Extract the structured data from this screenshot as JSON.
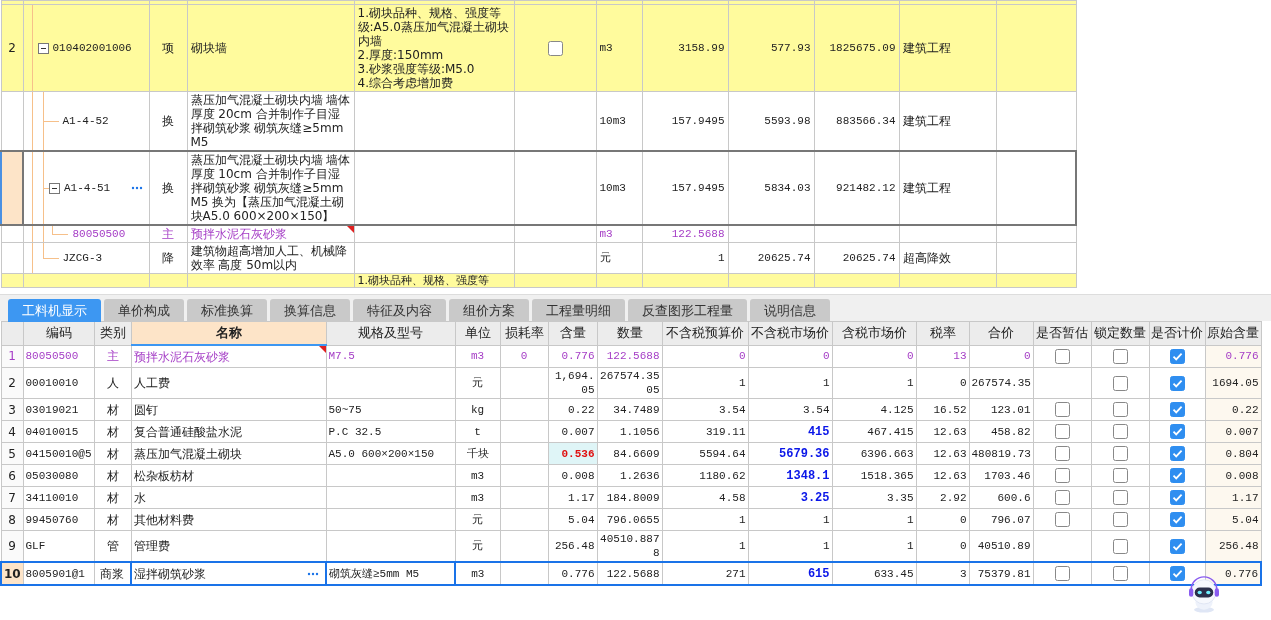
{
  "top_table": {
    "rows": [
      {
        "row_number": "2",
        "code": "010402001006",
        "type": "项",
        "kind": "item",
        "expanded": true,
        "name": "砌块墙",
        "features": "1.砌块品种、规格、强度等级:A5.0蒸压加气混凝土砌块内墙\n2.厚度:150mm\n3.砂浆强度等级:M5.0\n4.综合考虑增加费",
        "checked": false,
        "unit": "m3",
        "quantity": "3158.99",
        "unit_price": "577.93",
        "total": "1825675.09",
        "category": "建筑工程",
        "children": [
          {
            "code": "A1-4-52",
            "type": "换",
            "name": "蒸压加气混凝土砌块内墙 墙体厚度 20cm  合并制作子目湿拌砌筑砂浆 砌筑灰缝≥5mm M5",
            "unit": "10m3",
            "quantity": "157.9495",
            "unit_price": "5593.98",
            "total": "883566.34",
            "category": "建筑工程",
            "selected": false
          },
          {
            "code": "A1-4-51",
            "type": "换",
            "expanded": true,
            "name": "蒸压加气混凝土砌块内墙 墙体厚度 10cm  合并制作子目湿拌砌筑砂浆 砌筑灰缝≥5mm M5  换为【蒸压加气混凝土砌块A5.0 600×200×150】",
            "unit": "10m3",
            "quantity": "157.9495",
            "unit_price": "5834.03",
            "total": "921482.12",
            "category": "建筑工程",
            "selected": true,
            "children": [
              {
                "code": "80050500",
                "type": "主",
                "kind": "main-material",
                "name": "预拌水泥石灰砂浆",
                "flagged": true,
                "unit": "m3",
                "quantity": "122.5688",
                "selected": false
              }
            ]
          },
          {
            "code": "JZCG-3",
            "type": "降",
            "name": "建筑物超高增加人工、机械降效率 高度 50m以内",
            "unit": "元",
            "quantity": "1",
            "unit_price": "20625.74",
            "total": "20625.74",
            "category": "超高降效",
            "selected": false
          }
        ]
      },
      {
        "kind": "item",
        "features": "1.砌块品种、规格、强度等"
      }
    ]
  },
  "tabs": [
    {
      "label": "工料机显示",
      "selected": true
    },
    {
      "label": "单价构成",
      "selected": false
    },
    {
      "label": "标准换算",
      "selected": false
    },
    {
      "label": "换算信息",
      "selected": false
    },
    {
      "label": "特征及内容",
      "selected": false
    },
    {
      "label": "组价方案",
      "selected": false
    },
    {
      "label": "工程量明细",
      "selected": false
    },
    {
      "label": "反查图形工程量",
      "selected": false
    },
    {
      "label": "说明信息",
      "selected": false
    }
  ],
  "resource_table": {
    "columns": [
      {
        "label": "编码",
        "selected": false
      },
      {
        "label": "类别",
        "selected": false
      },
      {
        "label": "名称",
        "selected": true
      },
      {
        "label": "规格及型号",
        "selected": false
      },
      {
        "label": "单位",
        "selected": false
      },
      {
        "label": "损耗率",
        "selected": false
      },
      {
        "label": "含量",
        "selected": false
      },
      {
        "label": "数量",
        "selected": false
      },
      {
        "label": "不含税预算价",
        "selected": false
      },
      {
        "label": "不含税市场价",
        "selected": false
      },
      {
        "label": "含税市场价",
        "selected": false
      },
      {
        "label": "税率",
        "selected": false
      },
      {
        "label": "合价",
        "selected": false
      },
      {
        "label": "是否暂估",
        "selected": false
      },
      {
        "label": "锁定数量",
        "selected": false
      },
      {
        "label": "是否计价",
        "selected": false
      },
      {
        "label": "原始含量",
        "selected": false
      }
    ],
    "rows": [
      {
        "no": "1",
        "code": "80050500",
        "type": "主",
        "kind": "main-material",
        "flagged": true,
        "name": "预拌水泥石灰砂浆",
        "spec": "M7.5",
        "unit": "m3",
        "loss_rate": "0",
        "content": "0.776",
        "content_changed": false,
        "quantity": "122.5688",
        "budget_price": "0",
        "market_price": "0",
        "market_price_changed": false,
        "tax_market_price": "0",
        "tax_rate": "13",
        "total": "0",
        "provisional": false,
        "locked": false,
        "priced": true,
        "original_content": "0.776",
        "selected": false
      },
      {
        "no": "2",
        "code": "00010010",
        "type": "人",
        "kind": "normal",
        "name": "人工费",
        "unit": "元",
        "content": "1,694.05",
        "content_changed": false,
        "quantity": "267574.3505",
        "budget_price": "1",
        "market_price": "1",
        "market_price_changed": false,
        "tax_market_price": "1",
        "tax_rate": "0",
        "total": "267574.35",
        "locked": false,
        "priced": true,
        "original_content": "1694.05",
        "selected": false
      },
      {
        "no": "3",
        "code": "03019021",
        "type": "材",
        "kind": "normal",
        "name": "圆钉",
        "spec": "50~75",
        "unit": "kg",
        "content": "0.22",
        "content_changed": false,
        "quantity": "34.7489",
        "budget_price": "3.54",
        "market_price": "3.54",
        "market_price_changed": false,
        "tax_market_price": "4.125",
        "tax_rate": "16.52",
        "total": "123.01",
        "provisional": false,
        "locked": false,
        "priced": true,
        "original_content": "0.22",
        "selected": false
      },
      {
        "no": "4",
        "code": "04010015",
        "type": "材",
        "kind": "normal",
        "name": "复合普通硅酸盐水泥",
        "spec": "P.C 32.5",
        "unit": "t",
        "content": "0.007",
        "content_changed": false,
        "quantity": "1.1056",
        "budget_price": "319.11",
        "market_price": "415",
        "market_price_changed": true,
        "tax_market_price": "467.415",
        "tax_rate": "12.63",
        "total": "458.82",
        "provisional": false,
        "locked": false,
        "priced": true,
        "original_content": "0.007",
        "selected": false
      },
      {
        "no": "5",
        "code": "04150010@5",
        "type": "材",
        "kind": "normal",
        "name": "蒸压加气混凝土砌块",
        "spec": "A5.0 600×200×150",
        "unit": "千块",
        "content": "0.536",
        "content_changed": true,
        "quantity": "84.6609",
        "budget_price": "5594.64",
        "market_price": "5679.36",
        "market_price_changed": true,
        "tax_market_price": "6396.663",
        "tax_rate": "12.63",
        "total": "480819.73",
        "provisional": false,
        "locked": false,
        "priced": true,
        "original_content": "0.804",
        "selected": false
      },
      {
        "no": "6",
        "code": "05030080",
        "type": "材",
        "kind": "normal",
        "name": "松杂板枋材",
        "unit": "m3",
        "content": "0.008",
        "content_changed": false,
        "quantity": "1.2636",
        "budget_price": "1180.62",
        "market_price": "1348.1",
        "market_price_changed": true,
        "tax_market_price": "1518.365",
        "tax_rate": "12.63",
        "total": "1703.46",
        "provisional": false,
        "locked": false,
        "priced": true,
        "original_content": "0.008",
        "selected": false
      },
      {
        "no": "7",
        "code": "34110010",
        "type": "材",
        "kind": "normal",
        "name": "水",
        "unit": "m3",
        "content": "1.17",
        "content_changed": false,
        "quantity": "184.8009",
        "budget_price": "4.58",
        "market_price": "3.25",
        "market_price_changed": true,
        "tax_market_price": "3.35",
        "tax_rate": "2.92",
        "total": "600.6",
        "provisional": false,
        "locked": false,
        "priced": true,
        "original_content": "1.17",
        "selected": false
      },
      {
        "no": "8",
        "code": "99450760",
        "type": "材",
        "kind": "normal",
        "name": "其他材料费",
        "unit": "元",
        "content": "5.04",
        "content_changed": false,
        "quantity": "796.0655",
        "budget_price": "1",
        "market_price": "1",
        "market_price_changed": false,
        "tax_market_price": "1",
        "tax_rate": "0",
        "total": "796.07",
        "provisional": false,
        "locked": false,
        "priced": true,
        "original_content": "5.04",
        "selected": false
      },
      {
        "no": "9",
        "code": "GLF",
        "type": "管",
        "kind": "normal",
        "name": "管理费",
        "unit": "元",
        "content": "256.48",
        "content_changed": false,
        "quantity": "40510.8878",
        "budget_price": "1",
        "market_price": "1",
        "market_price_changed": false,
        "tax_market_price": "1",
        "tax_rate": "0",
        "total": "40510.89",
        "locked": false,
        "priced": true,
        "original_content": "256.48",
        "selected": false
      },
      {
        "no": "10",
        "code": "8005901@1",
        "type": "商浆",
        "kind": "normal",
        "name": "湿拌砌筑砂浆",
        "spec": "砌筑灰缝≥5mm M5",
        "unit": "m3",
        "content": "0.776",
        "content_changed": false,
        "quantity": "122.5688",
        "budget_price": "271",
        "market_price": "615",
        "market_price_changed": true,
        "tax_market_price": "633.45",
        "tax_rate": "3",
        "total": "75379.81",
        "provisional": false,
        "locked": false,
        "priced": true,
        "original_content": "0.776",
        "selected": true
      }
    ]
  }
}
